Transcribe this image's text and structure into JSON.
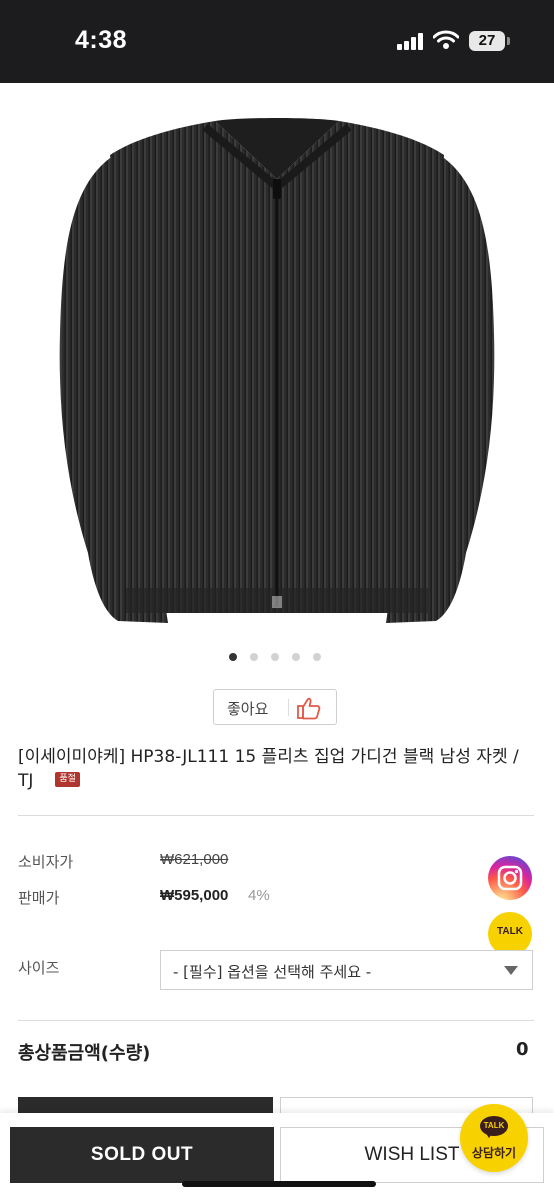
{
  "status_bar": {
    "time": "4:38",
    "battery": "27"
  },
  "product": {
    "title": "[이세이미야케] HP38-JL111 15 플리츠 집업 가디건 블랙 남성 자켓 / TJ",
    "badge": "품절",
    "image_icon": "black-pleated-zip-cardigan-image",
    "carousel_total": 5,
    "carousel_active": 1
  },
  "like": {
    "label": "좋아요",
    "icon": "thumbs-up-icon"
  },
  "price": {
    "consumer_label": "소비자가",
    "consumer_value": "₩621,000",
    "sale_label": "판매가",
    "sale_value": "₩595,000",
    "discount": "4%"
  },
  "option": {
    "label": "사이즈",
    "placeholder": "- [필수] 옵션을 선택해 주세요 -"
  },
  "total": {
    "label": "총상품금액(수량)",
    "value": "0"
  },
  "floating": {
    "instagram_icon": "instagram-icon",
    "talk_label": "TALK"
  },
  "bottom": {
    "sold_out": "SOLD OUT",
    "wishlist": "WISH LIST",
    "kakao_badge": "TALK",
    "kakao_label": "상담하기"
  },
  "colors": {
    "status_bar": "#1c1c1e",
    "sold_out_bg": "#2b2b2b",
    "badge_red": "#b0352f",
    "kakao_yellow": "#f7d200"
  }
}
